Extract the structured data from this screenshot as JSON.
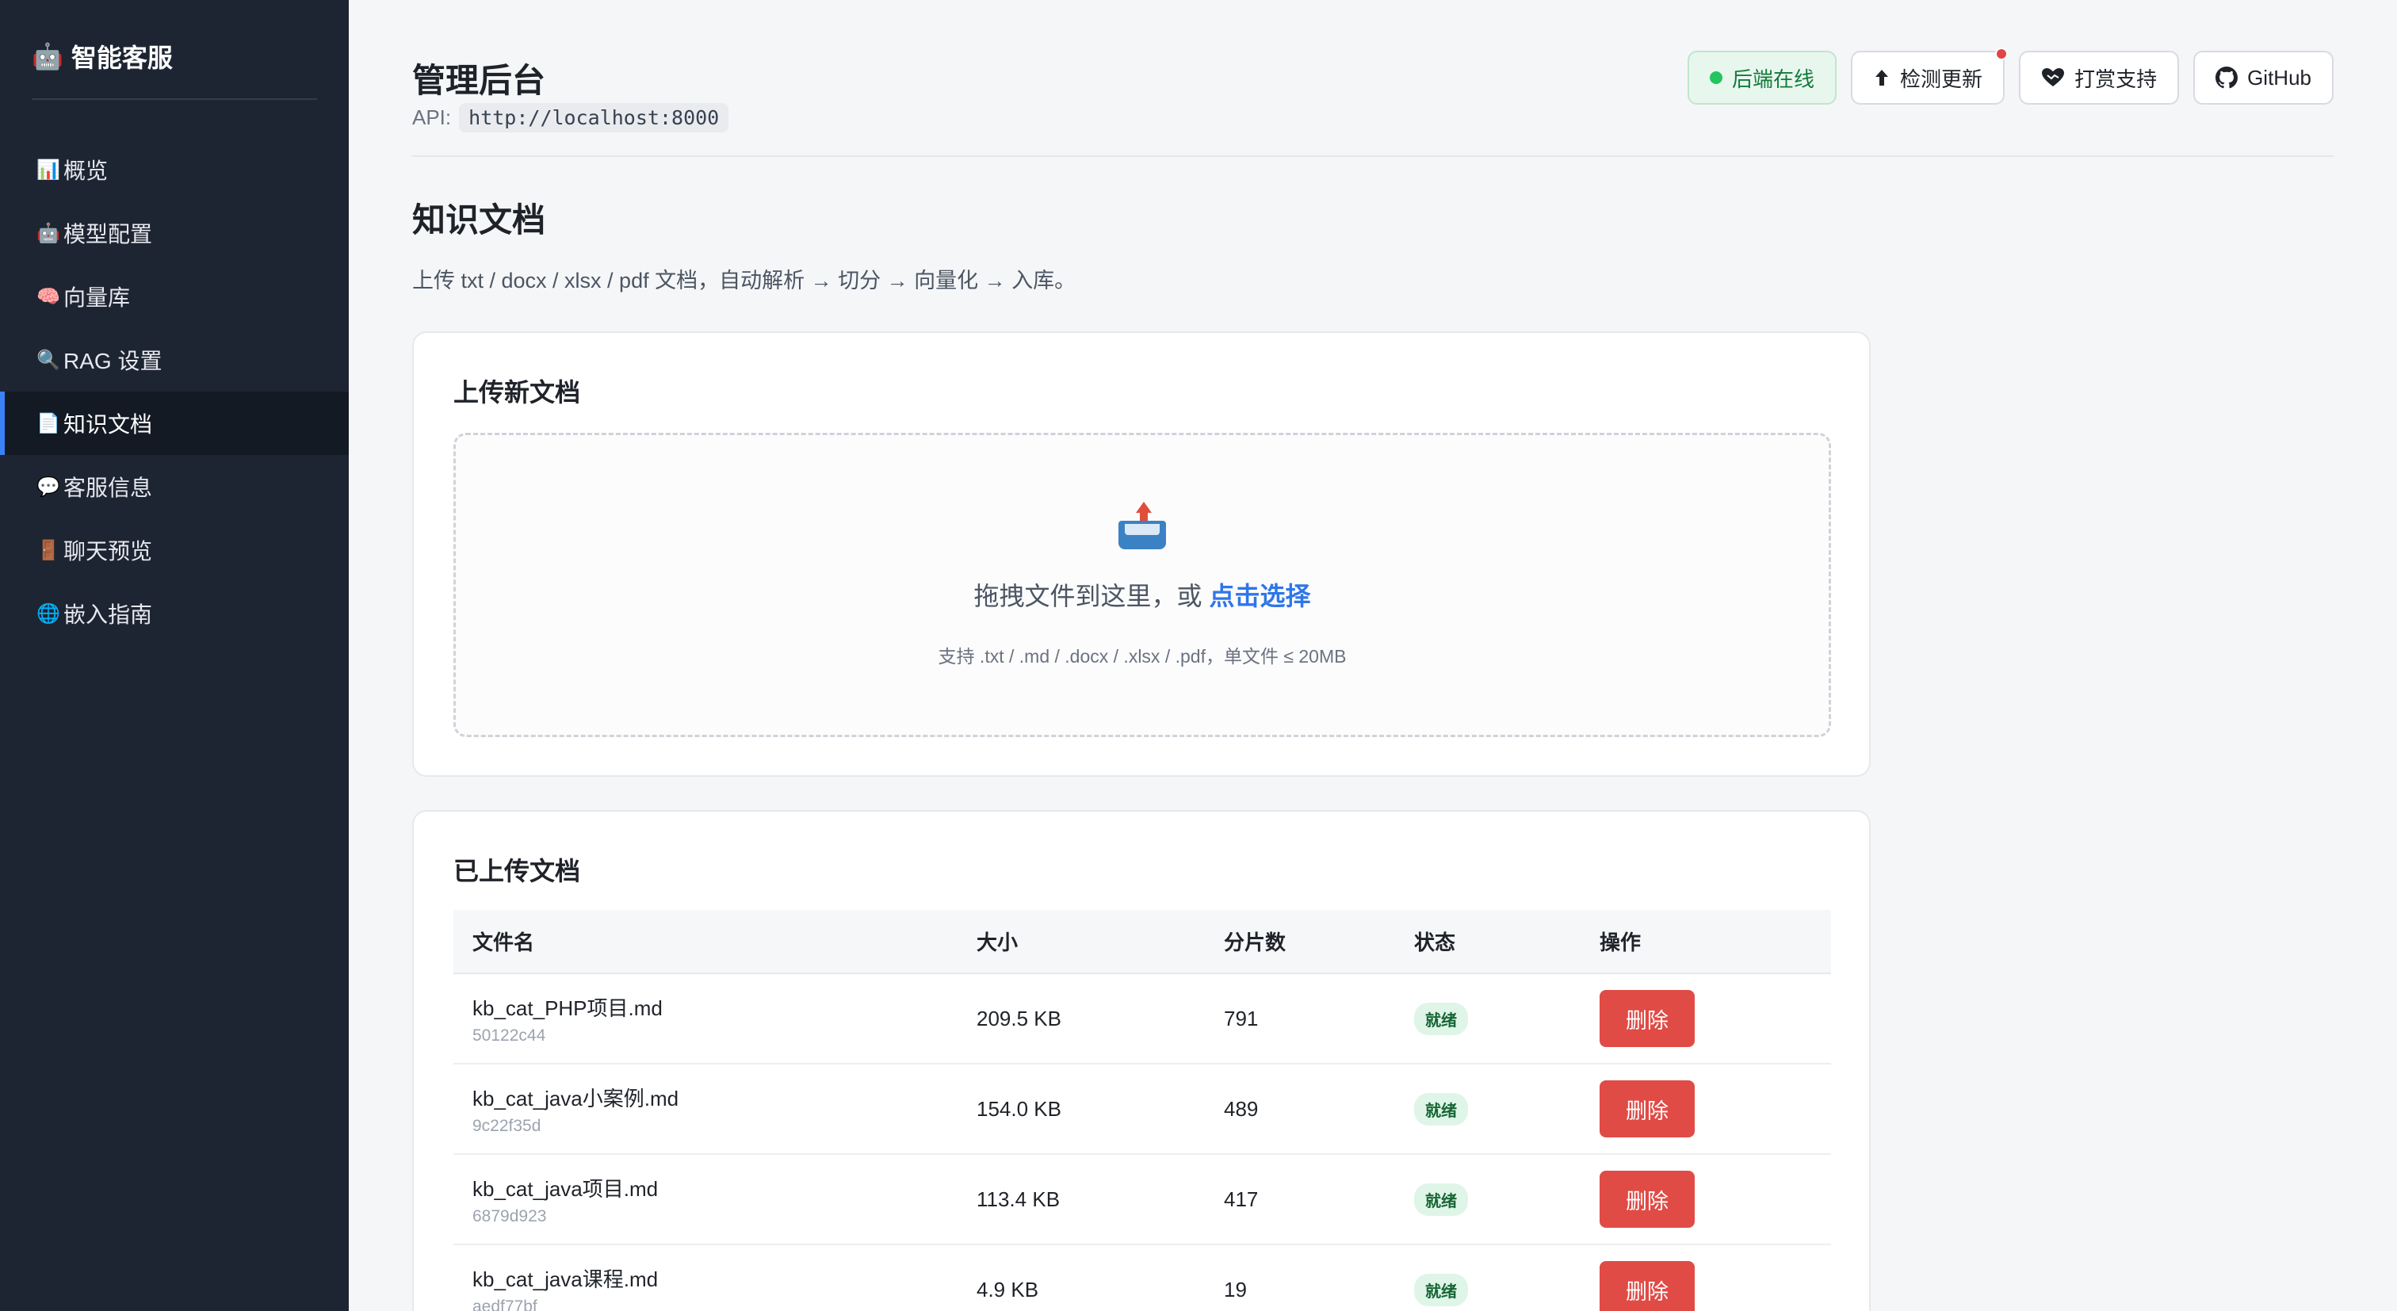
{
  "sidebar": {
    "brand": {
      "icon": "🤖",
      "label": "智能客服"
    },
    "items": [
      {
        "icon": "📊",
        "label": "概览"
      },
      {
        "icon": "🤖",
        "label": "模型配置"
      },
      {
        "icon": "🧠",
        "label": "向量库"
      },
      {
        "icon": "🔍",
        "label": "RAG 设置"
      },
      {
        "icon": "📄",
        "label": "知识文档"
      },
      {
        "icon": "💬",
        "label": "客服信息"
      },
      {
        "icon": "🚪",
        "label": "聊天预览"
      },
      {
        "icon": "🌐",
        "label": "嵌入指南"
      }
    ],
    "active_index": 4
  },
  "header": {
    "title": "管理后台",
    "api_label": "API:",
    "api_url": "http://localhost:8000",
    "status": "后端在线",
    "check_update": "检测更新",
    "donate": "打赏支持",
    "github": "GitHub"
  },
  "page": {
    "title": "知识文档",
    "description": "上传 txt / docx / xlsx / pdf 文档，自动解析 → 切分 → 向量化 → 入库。"
  },
  "upload": {
    "title": "上传新文档",
    "drop_text": "拖拽文件到这里，或",
    "drop_link": "点击选择",
    "hint": "支持 .txt / .md / .docx / .xlsx / .pdf，单文件 ≤ 20MB"
  },
  "docs": {
    "title": "已上传文档",
    "columns": [
      "文件名",
      "大小",
      "分片数",
      "状态",
      "操作"
    ],
    "rows": [
      {
        "name": "kb_cat_PHP项目.md",
        "id": "50122c44",
        "size": "209.5 KB",
        "chunks": "791",
        "status": "就绪",
        "action": "删除"
      },
      {
        "name": "kb_cat_java小案例.md",
        "id": "9c22f35d",
        "size": "154.0 KB",
        "chunks": "489",
        "status": "就绪",
        "action": "删除"
      },
      {
        "name": "kb_cat_java项目.md",
        "id": "6879d923",
        "size": "113.4 KB",
        "chunks": "417",
        "status": "就绪",
        "action": "删除"
      },
      {
        "name": "kb_cat_java课程.md",
        "id": "aedf77bf",
        "size": "4.9 KB",
        "chunks": "19",
        "status": "就绪",
        "action": "删除"
      }
    ]
  },
  "colors": {
    "sidebar_bg": "#1e2532",
    "accent": "#3b82f6",
    "danger": "#e04b46",
    "success": "#22c55e",
    "link": "#2f76e8"
  }
}
